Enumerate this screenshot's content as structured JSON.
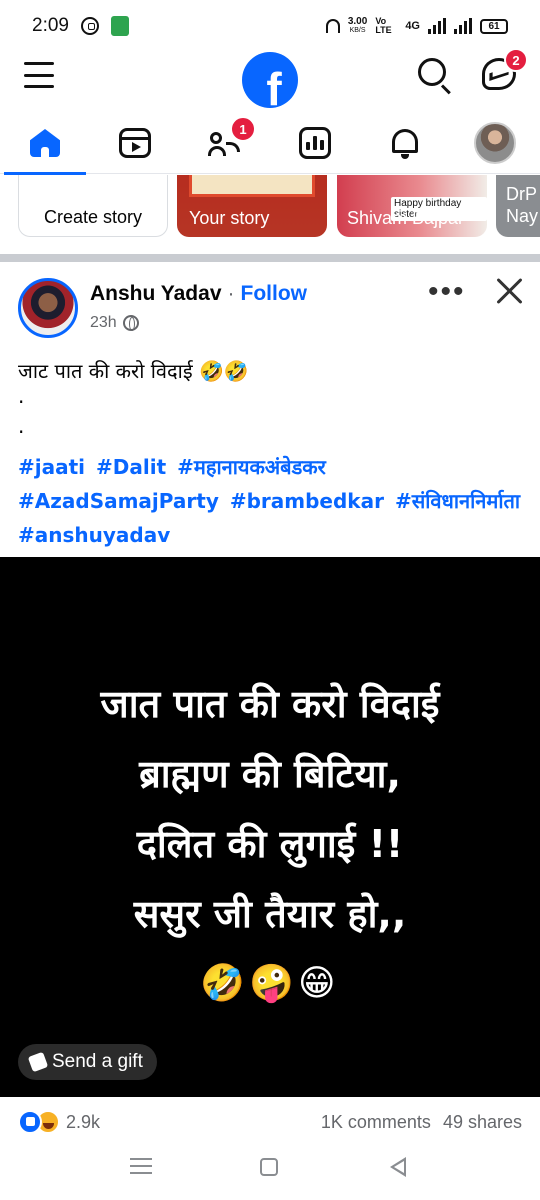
{
  "status_bar": {
    "time": "2:09",
    "net_speed": "3.00",
    "net_unit": "KB/S",
    "volte": "Vo LTE",
    "network": "4G",
    "battery": "61"
  },
  "header": {
    "logo_letter": "f",
    "messenger_badge": "2"
  },
  "tabs": {
    "friends_badge": "1"
  },
  "stories": [
    {
      "label": "Create story"
    },
    {
      "label": "Your story"
    },
    {
      "label": "Shivam Bajpai",
      "overlay": "Happy birthday sister"
    },
    {
      "label": "DrP Nay"
    }
  ],
  "post": {
    "author": "Anshu Yadav",
    "separator": "·",
    "follow_label": "Follow",
    "time": "23h",
    "text": "जाट पात की करो विदाई 🤣🤣",
    "dots": [
      ".",
      "."
    ],
    "hashtags": [
      "#jaati",
      "#Dalit",
      "#महानायकअंबेडकर",
      "#AzadSamajParty",
      "#brambedkar",
      "#संविधाननिर्माता",
      "#anshuyadav"
    ],
    "image_lines": [
      "जात पात की करो विदाई",
      "ब्राह्मण की बिटिया,",
      "दलित की लुगाई !!",
      "ससुर जी तैयार हो,,"
    ],
    "image_emojis": "🤣🤪😁",
    "gift_label": "Send a gift",
    "reaction_count": "2.9k",
    "comments": "1K comments",
    "shares": "49 shares"
  },
  "icons": {
    "menu": "hamburger-icon",
    "search": "search-icon",
    "messenger": "messenger-icon",
    "home": "home-icon",
    "reels": "reels-icon",
    "friends": "friends-icon",
    "dashboard": "dashboard-icon",
    "notifications": "bell-icon",
    "profile": "profile-avatar-icon",
    "more": "more-horizontal-icon",
    "close": "close-icon",
    "privacy": "globe-icon",
    "gift": "gift-icon",
    "like": "like-reaction-icon",
    "haha": "haha-reaction-icon"
  },
  "colors": {
    "brand": "#0866ff",
    "badge": "#e41e3f",
    "secondary_text": "#65676b"
  }
}
